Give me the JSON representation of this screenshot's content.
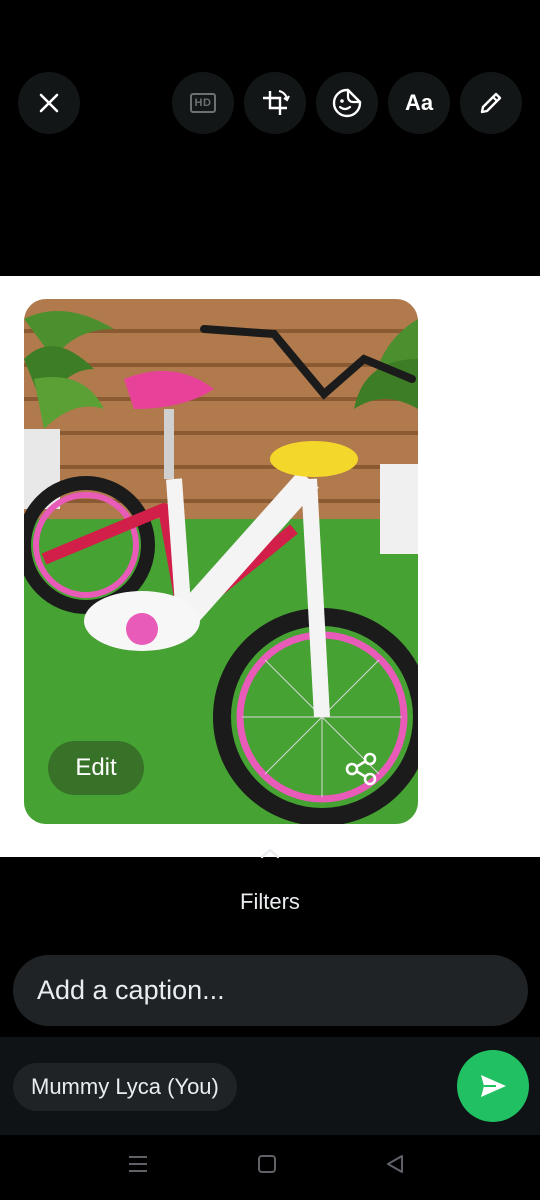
{
  "toolbar": {
    "close_icon": "close-icon",
    "hd_label": "HD",
    "crop_icon": "crop-rotate-icon",
    "sticker_icon": "sticker-icon",
    "text_label": "Aa",
    "draw_icon": "pencil-icon"
  },
  "media": {
    "edit_label": "Edit",
    "share_icon": "share-icon"
  },
  "filters": {
    "label": "Filters"
  },
  "caption": {
    "placeholder": "Add a caption..."
  },
  "recipient": {
    "name": "Mummy Lyca (You)"
  },
  "send": {
    "icon": "send-icon",
    "color": "#21c063"
  },
  "navbar": {
    "items": [
      "recents-icon",
      "home-icon",
      "back-icon"
    ]
  }
}
